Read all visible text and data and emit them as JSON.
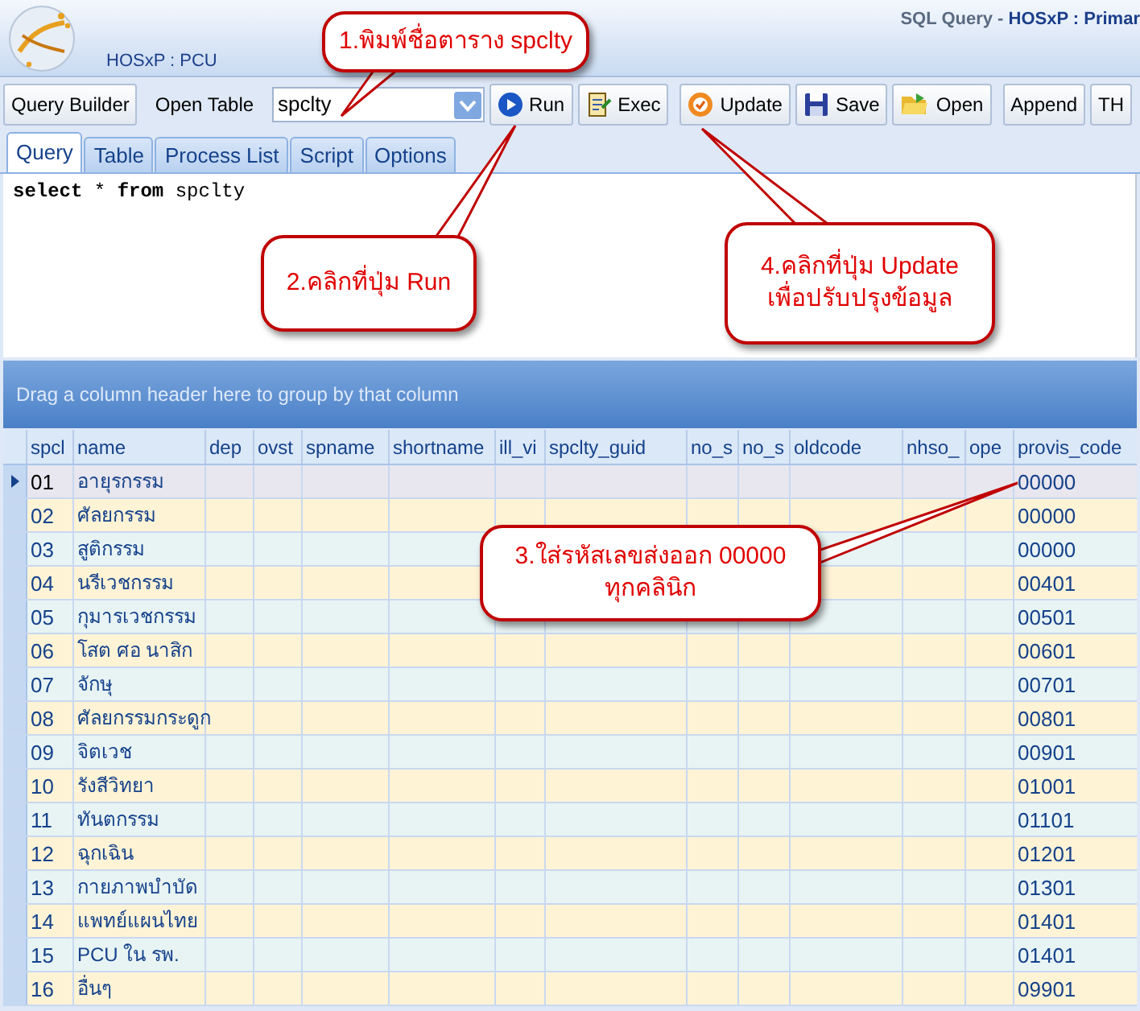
{
  "window": {
    "title": "SQL Query - ",
    "app_title": "HOSxP : Primar",
    "subtitle": "HOSxP : PCU"
  },
  "toolbar": {
    "query_builder": "Query Builder",
    "open_table_label": "Open Table",
    "table_combo": {
      "value": "spclty"
    },
    "buttons": [
      {
        "kind": "run",
        "label": "Run"
      },
      {
        "kind": "exec",
        "label": "Exec"
      },
      {
        "kind": "update",
        "label": "Update"
      },
      {
        "kind": "save",
        "label": "Save"
      },
      {
        "kind": "open",
        "label": "Open"
      },
      {
        "kind": "plain",
        "label": "Append"
      },
      {
        "kind": "plain",
        "label": "TH"
      }
    ]
  },
  "tabs": [
    {
      "label": "Query",
      "selected": true
    },
    {
      "label": "Table",
      "selected": false
    },
    {
      "label": "Process List",
      "selected": false
    },
    {
      "label": "Script",
      "selected": false
    },
    {
      "label": "Options",
      "selected": false
    }
  ],
  "editor": {
    "sql": "**select** * **from** spclty"
  },
  "grid": {
    "group_hint": "Drag a column header here to group by that column",
    "columns": [
      "spcl",
      "name",
      "dep",
      "ovst",
      "spname",
      "shortname",
      "ill_vi",
      "spclty_guid",
      "no_s",
      "no_s",
      "oldcode",
      "nhso_",
      "ope",
      "provis_code"
    ],
    "rows": [
      {
        "spcl": "01",
        "name": "อายุรกรรม",
        "provis_code": "00000",
        "selected": true
      },
      {
        "spcl": "02",
        "name": "ศัลยกรรม",
        "provis_code": "00000",
        "selected": false
      },
      {
        "spcl": "03",
        "name": "สูติกรรม",
        "provis_code": "00000",
        "selected": false
      },
      {
        "spcl": "04",
        "name": "นรีเวชกรรม",
        "provis_code": "00401",
        "selected": false
      },
      {
        "spcl": "05",
        "name": "กุมารเวชกรรม",
        "provis_code": "00501",
        "selected": false
      },
      {
        "spcl": "06",
        "name": "โสต ศอ นาสิก",
        "provis_code": "00601",
        "selected": false
      },
      {
        "spcl": "07",
        "name": "จักษุ",
        "provis_code": "00701",
        "selected": false
      },
      {
        "spcl": "08",
        "name": "ศัลยกรรมกระดูก",
        "provis_code": "00801",
        "selected": false
      },
      {
        "spcl": "09",
        "name": "จิตเวช",
        "provis_code": "00901",
        "selected": false
      },
      {
        "spcl": "10",
        "name": "รังสีวิทยา",
        "provis_code": "01001",
        "selected": false
      },
      {
        "spcl": "11",
        "name": "ทันตกรรม",
        "provis_code": "01101",
        "selected": false
      },
      {
        "spcl": "12",
        "name": "ฉุกเฉิน",
        "provis_code": "01201",
        "selected": false
      },
      {
        "spcl": "13",
        "name": "กายภาพบำบัด",
        "provis_code": "01301",
        "selected": false
      },
      {
        "spcl": "14",
        "name": "แพทย์แผนไทย",
        "provis_code": "01401",
        "selected": false
      },
      {
        "spcl": "15",
        "name": "PCU ใน รพ.",
        "provis_code": "01401",
        "selected": false
      },
      {
        "spcl": "16",
        "name": "อื่นๆ",
        "provis_code": "09901",
        "selected": false
      }
    ]
  },
  "callouts": [
    {
      "lines": [
        "1.พิมพ์ชื่อตาราง spclty"
      ]
    },
    {
      "lines": [
        "2.คลิกที่ปุ่ม Run"
      ]
    },
    {
      "lines": [
        "3.ใส่รหัสเลขส่งออก 00000",
        "ทุกคลินิก"
      ]
    },
    {
      "lines": [
        "4.คลิกที่ปุ่ม Update",
        "เพื่อปรับปรุงข้อมูล"
      ]
    }
  ]
}
